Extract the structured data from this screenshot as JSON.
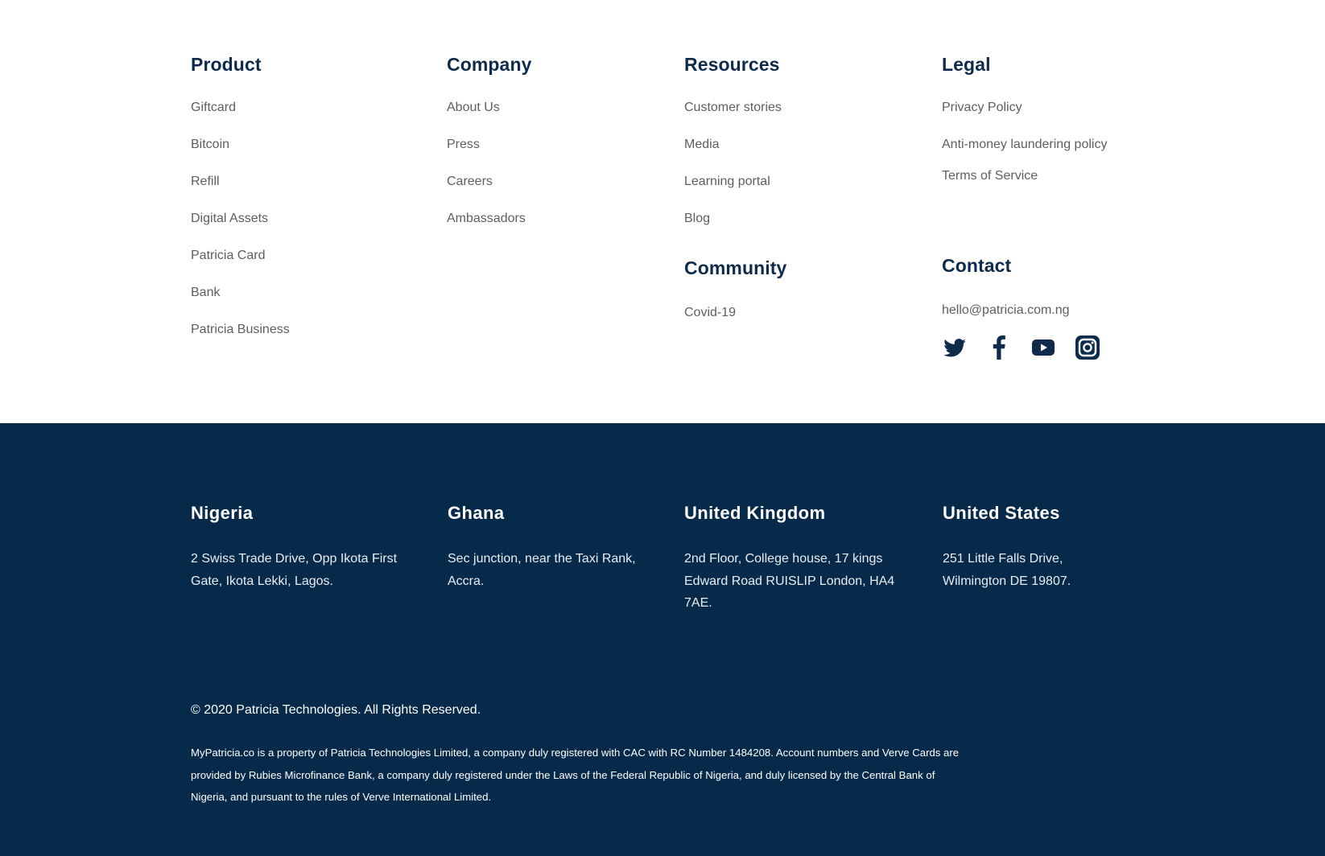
{
  "colors": {
    "heading": "#0e2b4c",
    "link": "#5c5e63",
    "footer_background": "#072a4a",
    "footer_text": "#ffffff"
  },
  "product": {
    "title": "Product",
    "links": [
      "Giftcard",
      "Bitcoin",
      "Refill",
      "Digital Assets",
      "Patricia Card",
      "Bank",
      "Patricia Business"
    ]
  },
  "company": {
    "title": "Company",
    "links": [
      "About Us",
      "Press",
      "Careers",
      "Ambassadors"
    ]
  },
  "resources": {
    "title": "Resources",
    "links": [
      "Customer stories",
      "Media",
      "Learning portal",
      "Blog"
    ]
  },
  "legal": {
    "title": "Legal",
    "links": [
      "Privacy Policy",
      "Anti-money laundering policy",
      "Terms of Service"
    ]
  },
  "community": {
    "title": "Community",
    "links": [
      "Covid-19"
    ]
  },
  "contact": {
    "title": "Contact",
    "email": "hello@patricia.com.ng",
    "socials": [
      "twitter-icon",
      "facebook-icon",
      "youtube-icon",
      "instagram-icon"
    ]
  },
  "offices": {
    "nigeria": {
      "name": "Nigeria",
      "address": "2 Swiss Trade Drive, Opp Ikota First Gate, Ikota Lekki, Lagos."
    },
    "ghana": {
      "name": "Ghana",
      "address": "Sec junction, near the Taxi Rank, Accra."
    },
    "uk": {
      "name": "United Kingdom",
      "address": "2nd Floor, College house, 17 kings Edward Road RUISLIP London, HA4 7AE."
    },
    "us": {
      "name": "United States",
      "address": "251 Little Falls Drive, Wilmington DE 19807."
    }
  },
  "legal_footer": {
    "copyright": "© 2020 Patricia Technologies. All Rights Reserved.",
    "disclaimer": "MyPatricia.co is a property of Patricia Technologies Limited, a company duly registered with CAC with RC Number 1484208. Account numbers and Verve Cards are provided by Rubies Microfinance Bank, a company duly registered under the Laws of the Federal Republic of Nigeria, and duly licensed by the Central Bank of Nigeria, and pursuant to the rules of Verve International Limited."
  }
}
